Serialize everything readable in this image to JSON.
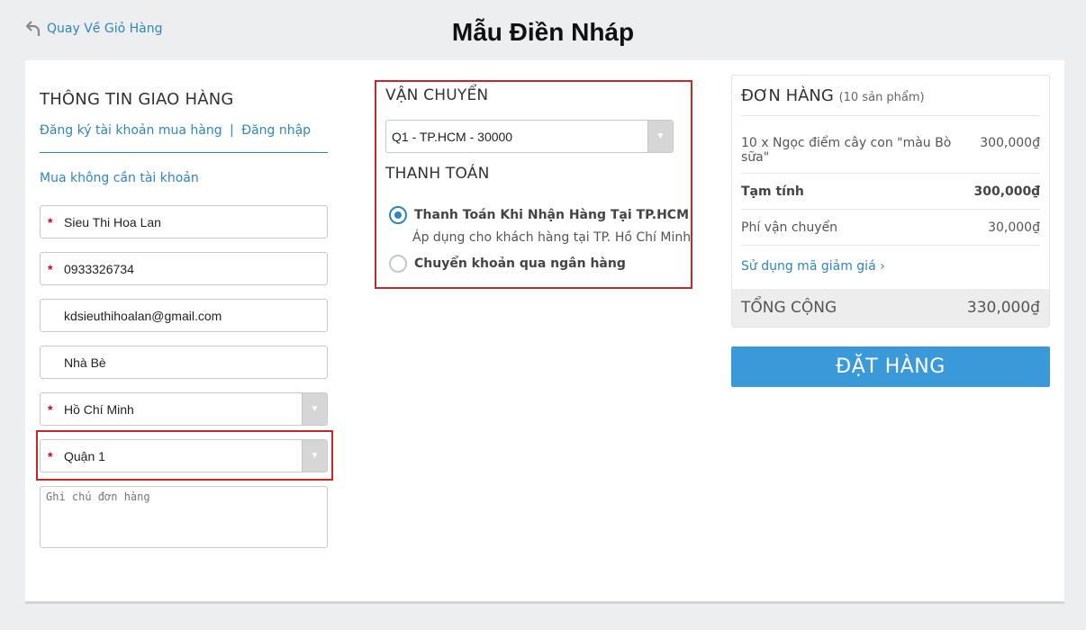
{
  "header": {
    "back_label": "Quay Về Giỏ Hàng",
    "title": "Mẫu Điền Nháp"
  },
  "delivery": {
    "title": "THÔNG TIN GIAO HÀNG",
    "register_link": "Đăng ký tài khoản mua hàng",
    "separator": "|",
    "login_link": "Đăng nhập",
    "guest_label": "Mua không cần tài khoản",
    "required_mark": "*",
    "name": "Sieu Thi Hoa Lan",
    "phone": "0933326734",
    "email": "kdsieuthihoalan@gmail.com",
    "address": "Nhà Bè",
    "province": "Hồ Chí Minh",
    "district": "Quận 1",
    "notes_placeholder": "Ghi chú đơn hàng",
    "arrow": "▼"
  },
  "shipping": {
    "title": "VẬN CHUYỂN",
    "selected": "Q1 - TP.HCM - 30000"
  },
  "payment": {
    "title": "THANH TOÁN",
    "options": [
      {
        "label": "Thanh Toán Khi Nhận Hàng Tại TP.HCM",
        "desc": "Áp dụng cho khách hàng tại TP. Hồ Chí Minh",
        "selected": true
      },
      {
        "label": "Chuyển khoản qua ngân hàng",
        "selected": false
      }
    ]
  },
  "order": {
    "title": "ĐƠN HÀNG",
    "count": "(10 sản phẩm)",
    "item_label": "10 x Ngọc điểm cây con \"màu Bò sữa\"",
    "item_price": "300,000₫",
    "subtotal_label": "Tạm tính",
    "subtotal_value": "300,000₫",
    "shipping_label": "Phí vận chuyển",
    "shipping_value": "30,000₫",
    "coupon_label": "Sử dụng mã giảm giá",
    "coupon_chevron": "›",
    "total_label": "TỔNG CỘNG",
    "total_value": "330,000₫",
    "submit_label": "ĐẶT HÀNG"
  },
  "colors": {
    "accent": "#2e86c1",
    "button": "#3a9ad9",
    "highlight_border": "#c62828",
    "required": "#d0021b"
  }
}
